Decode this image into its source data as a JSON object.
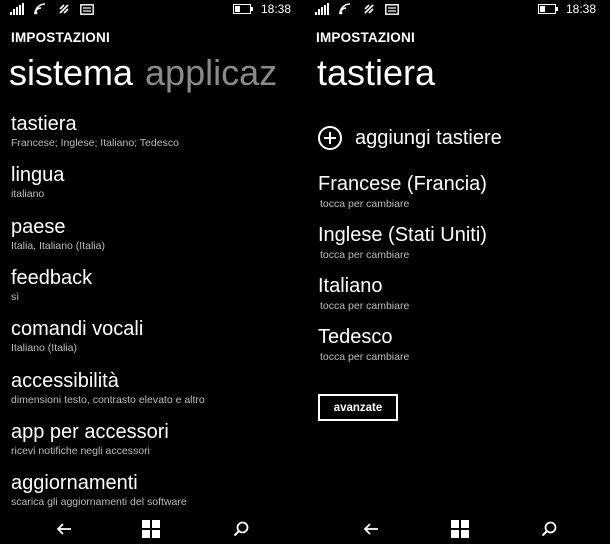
{
  "status": {
    "time": "18:38",
    "battery_level": 0.3
  },
  "left": {
    "section": "IMPOSTAZIONI",
    "pivot_active": "sistema",
    "pivot_next": "applicaz",
    "items": [
      {
        "label": "tastiera",
        "sub": "Francese; Inglese; Italiano; Tedesco"
      },
      {
        "label": "lingua",
        "sub": "italiano"
      },
      {
        "label": "paese",
        "sub": "Italia, Italiano (Italia)"
      },
      {
        "label": "feedback",
        "sub": "sì"
      },
      {
        "label": "comandi vocali",
        "sub": "Italiano (Italia)"
      },
      {
        "label": "accessibilità",
        "sub": "dimensioni testo, contrasto elevato e altro"
      },
      {
        "label": "app per accessori",
        "sub": "ricevi notifiche negli accessori"
      },
      {
        "label": "aggiornamenti",
        "sub": "scarica gli aggiornamenti del software"
      }
    ]
  },
  "right": {
    "section": "IMPOSTAZIONI",
    "title": "tastiera",
    "add_label": "aggiungi tastiere",
    "keyboards": [
      {
        "label": "Francese (Francia)",
        "sub": "tocca per cambiare"
      },
      {
        "label": "Inglese (Stati Uniti)",
        "sub": "tocca per cambiare"
      },
      {
        "label": "Italiano",
        "sub": "tocca per cambiare"
      },
      {
        "label": "Tedesco",
        "sub": "tocca per cambiare"
      }
    ],
    "advanced_button": "avanzate"
  },
  "icons": {
    "status_left": [
      "signal-icon",
      "wifi-icon",
      "data-sense-icon",
      "message-icon"
    ],
    "nav": [
      "back-icon",
      "windows-icon",
      "search-icon"
    ]
  }
}
